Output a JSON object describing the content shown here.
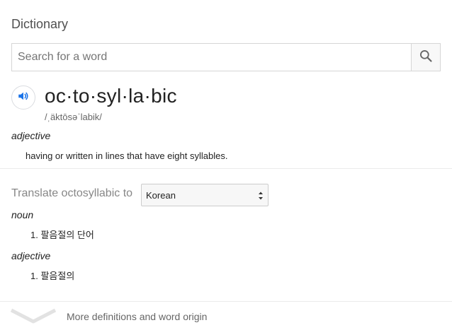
{
  "panel": {
    "title": "Dictionary"
  },
  "search": {
    "placeholder": "Search for a word",
    "icon": "search-icon"
  },
  "entry": {
    "audio_icon": "speaker-icon",
    "headword": "oc·to·syl·la·bic",
    "phonetic": "/ˌäktōsəˈlabik/",
    "part_of_speech": "adjective",
    "definition": "having or written in lines that have eight syllables."
  },
  "translate": {
    "label": "Translate octosyllabic to",
    "selected_language": "Korean",
    "groups": [
      {
        "part_of_speech": "noun",
        "items": [
          "1. 팔음절의 단어"
        ]
      },
      {
        "part_of_speech": "adjective",
        "items": [
          "1. 팔음절의"
        ]
      }
    ]
  },
  "footer": {
    "more_label": "More definitions and word origin",
    "icon": "chevron-down-icon"
  },
  "colors": {
    "accent": "#1a73e8",
    "divider": "#ebebeb",
    "muted_text": "#878787"
  }
}
